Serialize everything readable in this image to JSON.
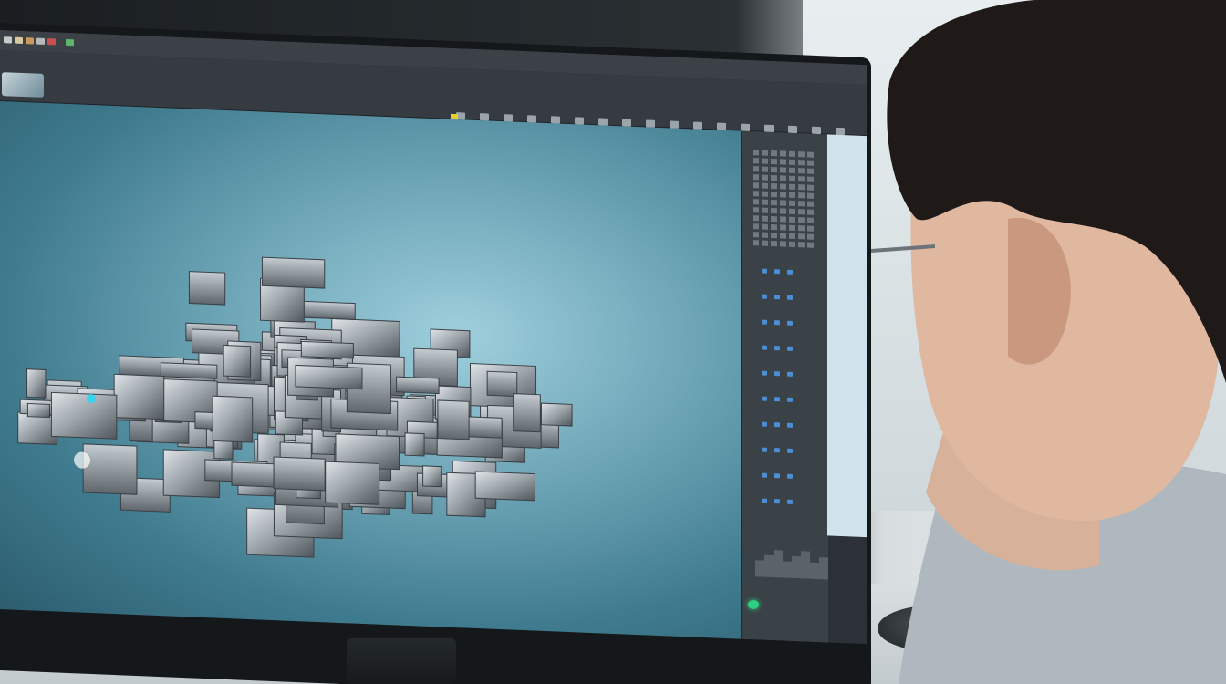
{
  "scene": {
    "description_tag": "photo",
    "colors": {
      "viewport_center": "#9fcfdd",
      "viewport_edge": "#2c5d6e",
      "toolbar": "#353b40",
      "menubar": "#3b4146",
      "panel": "#3a4147",
      "accent_yellow": "#e6cf2b",
      "accent_blue": "#4a8fd6",
      "power_led": "#2ed07f"
    }
  },
  "icons": {
    "app_logo": "app-logo-icon",
    "selection_tool": "select-tool-icon",
    "power_led": "power-led-icon"
  }
}
